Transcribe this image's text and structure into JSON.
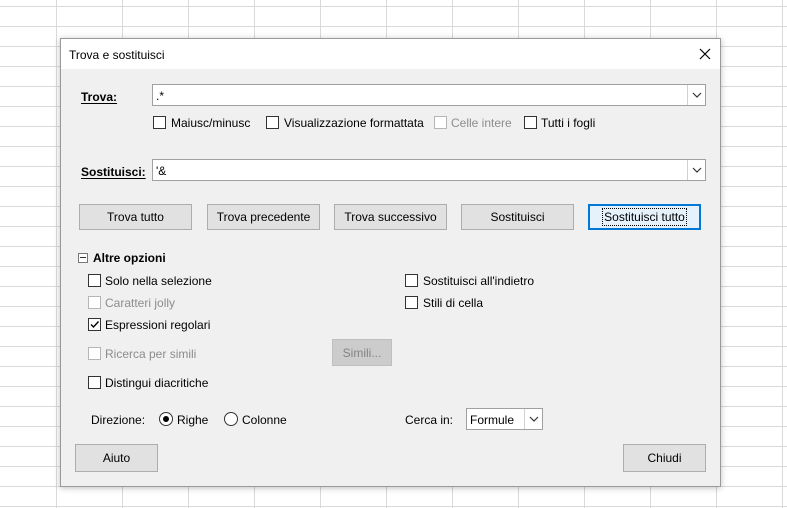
{
  "dialog": {
    "title": "Trova e sostituisci",
    "find_label": "Trova:",
    "find_value": ".*",
    "replace_label": "Sostituisci:",
    "replace_value": "'&",
    "options_row": [
      {
        "label": "Maiusc/minusc",
        "checked": false,
        "enabled": true
      },
      {
        "label": "Visualizzazione formattata",
        "checked": false,
        "enabled": true
      },
      {
        "label": "Celle intere",
        "checked": false,
        "enabled": false
      },
      {
        "label": "Tutti i fogli",
        "checked": false,
        "enabled": true
      }
    ],
    "buttons": {
      "find_all": "Trova tutto",
      "find_prev": "Trova precedente",
      "find_next": "Trova successivo",
      "replace": "Sostituisci",
      "replace_all": "Sostituisci tutto"
    },
    "more_options": {
      "label": "Altre opzioni",
      "left": [
        {
          "label": "Solo nella selezione",
          "checked": false,
          "enabled": true
        },
        {
          "label": "Caratteri jolly",
          "checked": false,
          "enabled": false
        },
        {
          "label": "Espressioni regolari",
          "checked": true,
          "enabled": true
        },
        {
          "label": "Ricerca per simili",
          "checked": false,
          "enabled": false
        },
        {
          "label": "Distingui diacritiche",
          "checked": false,
          "enabled": true
        }
      ],
      "right": [
        {
          "label": "Sostituisci all'indietro",
          "checked": false,
          "enabled": true
        },
        {
          "label": "Stili di cella",
          "checked": false,
          "enabled": true
        }
      ],
      "similarity_button": "Simili...",
      "direction_label": "Direzione:",
      "direction_options": [
        {
          "label": "Righe",
          "selected": true
        },
        {
          "label": "Colonne",
          "selected": false
        }
      ],
      "search_in_label": "Cerca in:",
      "search_in_value": "Formule"
    },
    "help_button": "Aiuto",
    "close_button": "Chiudi"
  }
}
